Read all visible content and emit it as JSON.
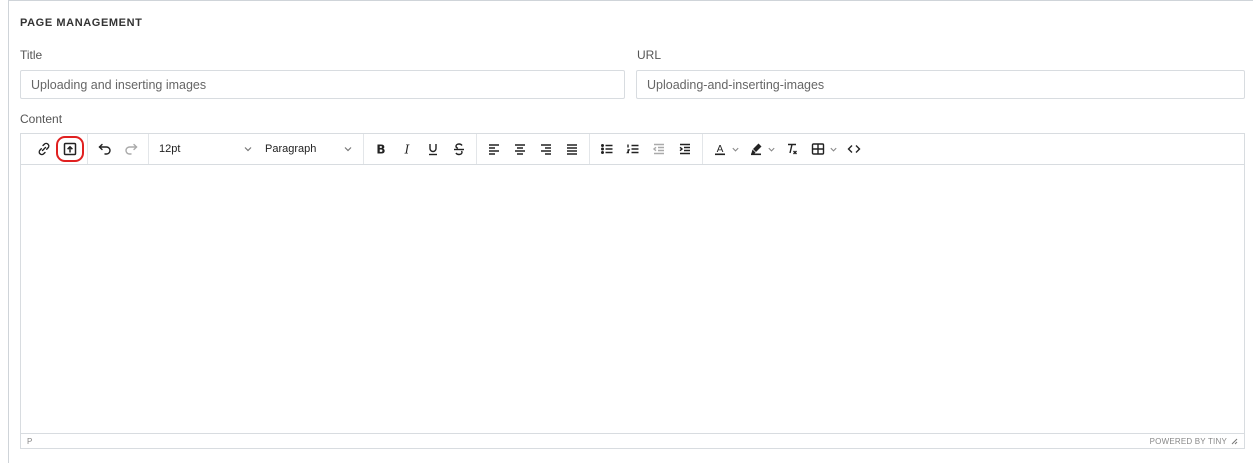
{
  "section": {
    "title": "PAGE MANAGEMENT"
  },
  "form": {
    "title_label": "Title",
    "title_value": "Uploading and inserting images",
    "url_label": "URL",
    "url_value": "Uploading-and-inserting-images",
    "content_label": "Content"
  },
  "editor": {
    "toolbar": {
      "font_size": "12pt",
      "block_format": "Paragraph",
      "buttons": [
        "link",
        "upload-image",
        "undo",
        "redo",
        "bold",
        "italic",
        "underline",
        "strikethrough",
        "align-left",
        "align-center",
        "align-right",
        "justify",
        "bullet-list",
        "numbered-list",
        "outdent",
        "indent",
        "text-color",
        "highlight-color",
        "clear-formatting",
        "table",
        "source-code"
      ]
    },
    "status": {
      "path": "P",
      "powered_by": "POWERED BY TINY"
    },
    "highlight_color": "#e02020"
  }
}
